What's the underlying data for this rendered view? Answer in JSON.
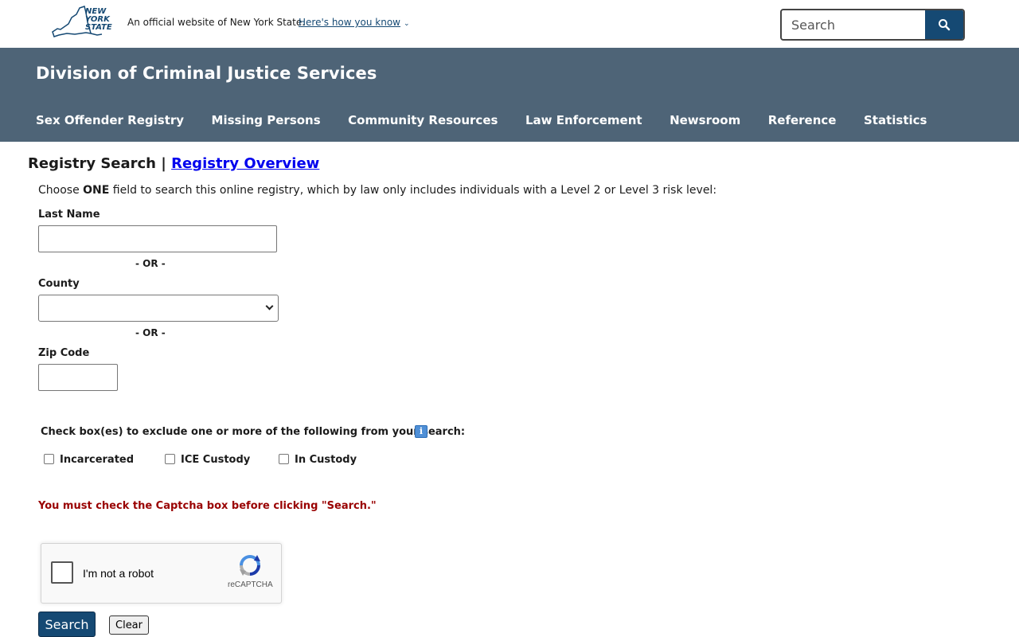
{
  "header": {
    "logo_text": "NEW YORK STATE",
    "official_text": "An official website of New York State.",
    "how_you_know": "Here's how you know",
    "search": {
      "placeholder": "Search",
      "value": ""
    },
    "icons": {
      "logo": "ny-state-logo",
      "search": "search-icon",
      "chevron": "chevron-down-icon"
    }
  },
  "agency": {
    "title": "Division of Criminal Justice Services",
    "nav": [
      "Sex Offender Registry",
      "Missing Persons",
      "Community Resources",
      "Law Enforcement",
      "Newsroom",
      "Reference",
      "Statistics"
    ]
  },
  "main": {
    "heading": "Registry Search",
    "heading_sep": " | ",
    "overview_link": "Registry Overview",
    "instruction_pre": "Choose ",
    "instruction_bold": "ONE",
    "instruction_post": " field to search this online registry, which by law only includes individuals with a Level 2 or Level 3 risk level:",
    "last_name_label": "Last Name",
    "last_name_value": "",
    "or_1": "- OR -",
    "county_label": "County",
    "county_selected": "",
    "or_2": "- OR -",
    "zip_label": "Zip Code",
    "zip_value": "",
    "exclude_text": "Check box(es) to exclude one or more of the following from your search:",
    "info_icon": "i",
    "checkboxes": [
      {
        "label": "Incarcerated",
        "checked": false
      },
      {
        "label": "ICE Custody",
        "checked": false
      },
      {
        "label": "In Custody",
        "checked": false
      }
    ],
    "captcha_warning": "You must check the Captcha box before clicking \"Search.\"",
    "recaptcha": {
      "label": "I'm not a robot",
      "brand": "reCAPTCHA"
    },
    "search_button": "Search",
    "clear_button": "Clear"
  },
  "colors": {
    "banner": "#4e6477",
    "primary": "#154973",
    "warning": "#990000",
    "link": "#0000ee"
  }
}
